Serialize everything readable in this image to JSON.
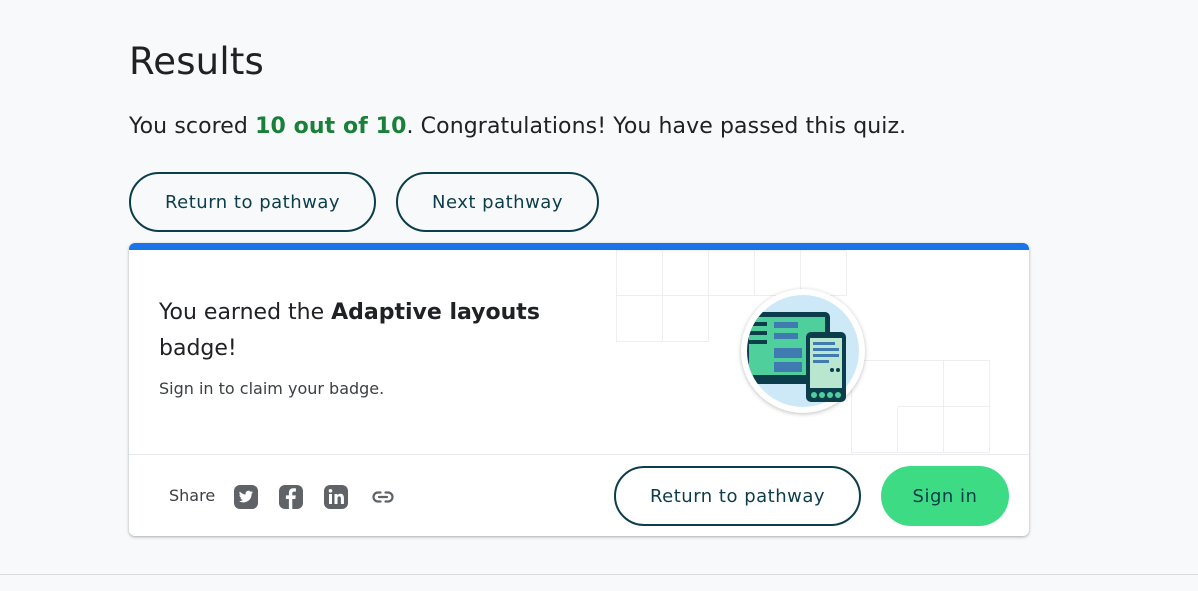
{
  "results": {
    "title": "Results",
    "score_prefix": "You scored ",
    "score_value": "10 out of 10",
    "score_suffix": ". Congratulations! You have passed this quiz."
  },
  "actions": {
    "return_label": "Return to pathway",
    "next_label": "Next pathway"
  },
  "badge_card": {
    "earned_prefix": "You earned the ",
    "badge_name": "Adaptive layouts",
    "earned_suffix": " badge!",
    "claim_text": "Sign in to claim your badge.",
    "share_label": "Share",
    "share_icons": [
      "twitter-icon",
      "facebook-icon",
      "linkedin-icon",
      "link-icon"
    ],
    "return_label": "Return to pathway",
    "sign_in_label": "Sign in"
  },
  "colors": {
    "accent_bar": "#1a73e8",
    "score_highlight": "#188038",
    "primary_button": "#3ddc84",
    "outline_button": "#0b3d4a"
  }
}
